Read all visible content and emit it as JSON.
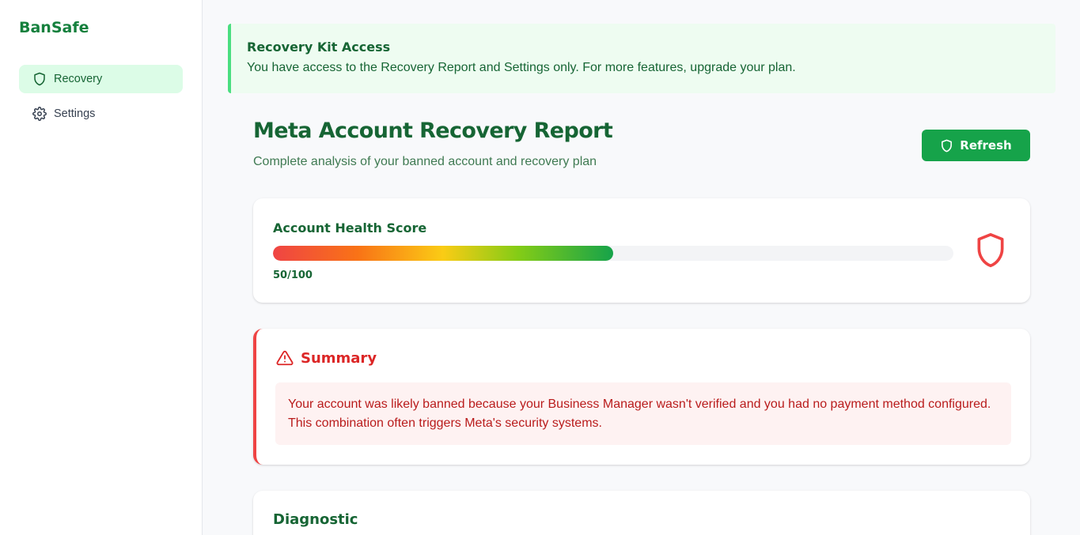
{
  "app": {
    "brand": "BanSafe"
  },
  "sidebar": {
    "items": [
      {
        "label": "Recovery",
        "icon": "shield-icon",
        "active": true
      },
      {
        "label": "Settings",
        "icon": "gear-icon",
        "active": false
      }
    ]
  },
  "banner": {
    "title": "Recovery Kit Access",
    "text": "You have access to the Recovery Report and Settings only. For more features, upgrade your plan."
  },
  "header": {
    "title": "Meta Account Recovery Report",
    "subtitle": "Complete analysis of your banned account and recovery plan",
    "refresh_label": "Refresh"
  },
  "health": {
    "title": "Account Health Score",
    "score": 50,
    "max": 100,
    "score_text": "50/100"
  },
  "summary": {
    "title": "Summary",
    "text": "Your account was likely banned because your Business Manager wasn't verified and you had no payment method configured. This combination often triggers Meta's security systems."
  },
  "diagnostic": {
    "title": "Diagnostic"
  },
  "colors": {
    "brand_green": "#15803d",
    "button_green": "#16a34a",
    "alert_red": "#ef4444",
    "banner_bg": "#eefcf1"
  }
}
